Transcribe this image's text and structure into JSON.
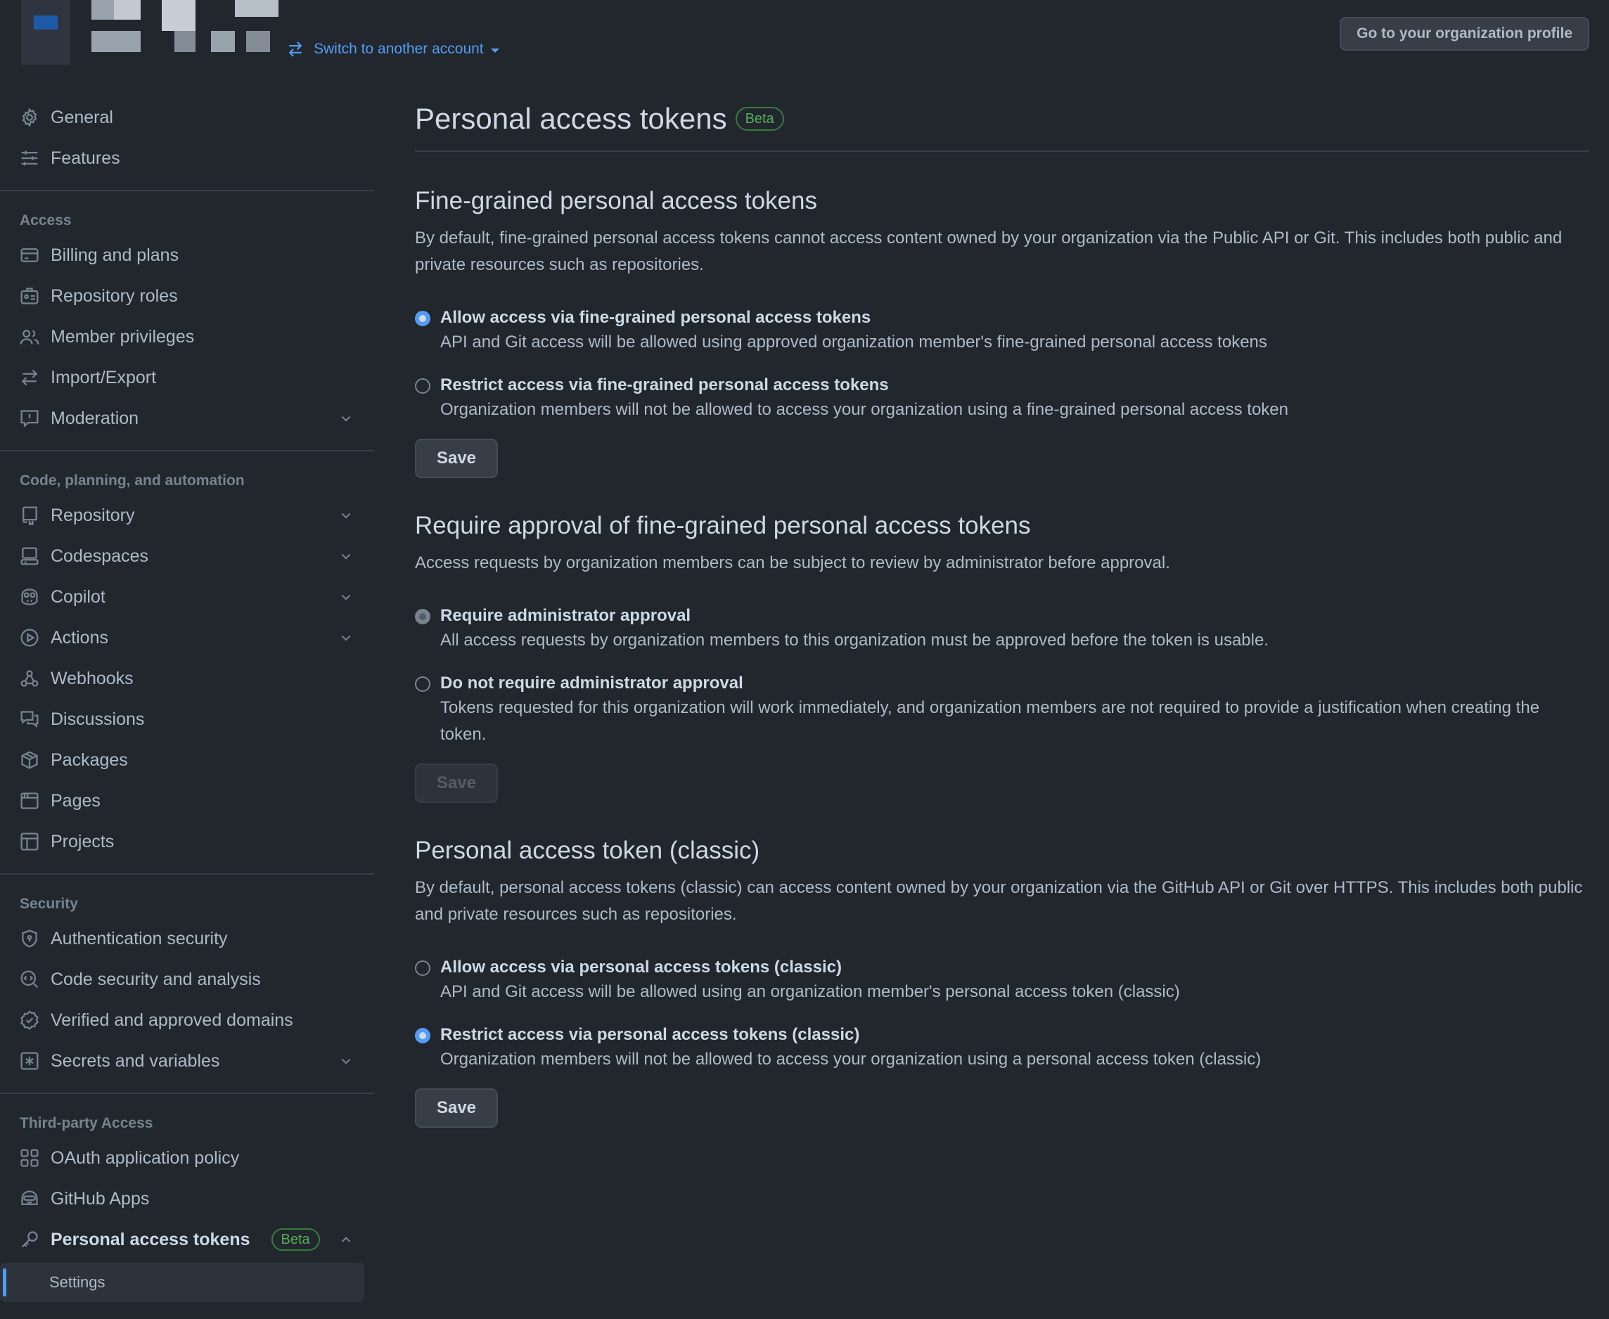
{
  "header": {
    "switch_account": "Switch to another account",
    "org_profile_button": "Go to your organization profile"
  },
  "sidebar": {
    "top_items": [
      {
        "label": "General",
        "icon": "gear-icon"
      },
      {
        "label": "Features",
        "icon": "sliders-icon"
      }
    ],
    "sections": [
      {
        "heading": "Access",
        "items": [
          {
            "label": "Billing and plans",
            "icon": "credit-card-icon"
          },
          {
            "label": "Repository roles",
            "icon": "id-badge-icon"
          },
          {
            "label": "Member privileges",
            "icon": "people-icon"
          },
          {
            "label": "Import/Export",
            "icon": "arrow-switch-icon"
          },
          {
            "label": "Moderation",
            "icon": "report-icon",
            "expandable": true
          }
        ]
      },
      {
        "heading": "Code, planning, and automation",
        "items": [
          {
            "label": "Repository",
            "icon": "repo-icon",
            "expandable": true
          },
          {
            "label": "Codespaces",
            "icon": "codespaces-icon",
            "expandable": true
          },
          {
            "label": "Copilot",
            "icon": "copilot-icon",
            "expandable": true
          },
          {
            "label": "Actions",
            "icon": "play-icon",
            "expandable": true
          },
          {
            "label": "Webhooks",
            "icon": "webhook-icon"
          },
          {
            "label": "Discussions",
            "icon": "comment-discussion-icon"
          },
          {
            "label": "Packages",
            "icon": "package-icon"
          },
          {
            "label": "Pages",
            "icon": "browser-icon"
          },
          {
            "label": "Projects",
            "icon": "table-icon"
          }
        ]
      },
      {
        "heading": "Security",
        "items": [
          {
            "label": "Authentication security",
            "icon": "shield-lock-icon"
          },
          {
            "label": "Code security and analysis",
            "icon": "codescan-icon"
          },
          {
            "label": "Verified and approved domains",
            "icon": "verified-icon"
          },
          {
            "label": "Secrets and variables",
            "icon": "asterisk-icon",
            "expandable": true
          }
        ]
      },
      {
        "heading": "Third-party Access",
        "items": [
          {
            "label": "OAuth application policy",
            "icon": "apps-icon"
          },
          {
            "label": "GitHub Apps",
            "icon": "hubot-icon"
          }
        ]
      }
    ],
    "pat_item": {
      "label": "Personal access tokens",
      "badge": "Beta",
      "icon": "key-icon"
    },
    "pat_sub": {
      "label": "Settings"
    }
  },
  "main": {
    "title": "Personal access tokens",
    "title_badge": "Beta",
    "fine_grained": {
      "title": "Fine-grained personal access tokens",
      "description": "By default, fine-grained personal access tokens cannot access content owned by your organization via the Public API or Git. This includes both public and private resources such as repositories.",
      "options": [
        {
          "label": "Allow access via fine-grained personal access tokens",
          "note": "API and Git access will be allowed using approved organization member's fine-grained personal access tokens",
          "checked": true
        },
        {
          "label": "Restrict access via fine-grained personal access tokens",
          "note": "Organization members will not be allowed to access your organization using a fine-grained personal access token",
          "checked": false
        }
      ],
      "save": "Save"
    },
    "approval": {
      "title": "Require approval of fine-grained personal access tokens",
      "description": "Access requests by organization members can be subject to review by administrator before approval.",
      "options": [
        {
          "label": "Require administrator approval",
          "note": "All access requests by organization members to this organization must be approved before the token is usable.",
          "checked": true
        },
        {
          "label": "Do not require administrator approval",
          "note": "Tokens requested for this organization will work immediately, and organization members are not required to provide a justification when creating the token.",
          "checked": false
        }
      ],
      "save": "Save"
    },
    "classic": {
      "title": "Personal access token (classic)",
      "description": "By default, personal access tokens (classic) can access content owned by your organization via the GitHub API or Git over HTTPS. This includes both public and private resources such as repositories.",
      "options": [
        {
          "label": "Allow access via personal access tokens (classic)",
          "note": "API and Git access will be allowed using an organization member's personal access token (classic)",
          "checked": false
        },
        {
          "label": "Restrict access via personal access tokens (classic)",
          "note": "Organization members will not be allowed to access your organization using a personal access token (classic)",
          "checked": true
        }
      ],
      "save": "Save"
    }
  },
  "colors": {
    "background": "#22272e",
    "accent": "#539bf5",
    "beta_green": "#57ab5a"
  }
}
